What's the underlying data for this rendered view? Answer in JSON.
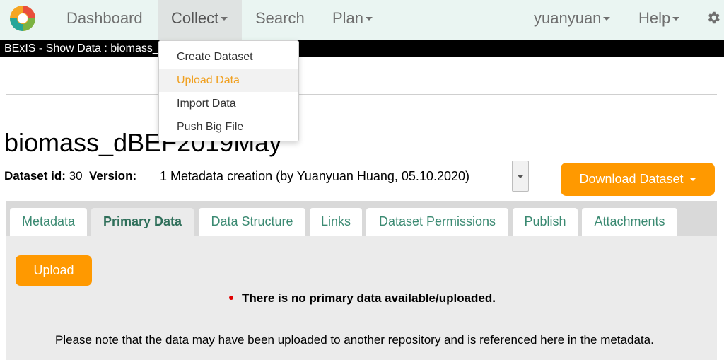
{
  "nav": {
    "items": [
      "Dashboard",
      "Collect",
      "Search",
      "Plan"
    ],
    "user": "yuanyuan",
    "help": "Help",
    "settings_icon": "gear-icon",
    "logo_icon": "bexis-logo"
  },
  "titlebar": {
    "text": "BExIS - Show Data : biomass_dBEF2019May"
  },
  "collect_menu": {
    "items": [
      "Create Dataset",
      "Upload Data",
      "Import Data",
      "Push Big File"
    ],
    "highlighted": "Upload Data",
    "highlight_color": "#f0a020"
  },
  "dataset": {
    "title": "biomass_dBEF2019May",
    "id_label": "Dataset id:",
    "id_value": "30",
    "version_label": "Version:",
    "version_value": "1 Metadata creation (by Yuanyuan Huang, 05.10.2020)",
    "download_label": "Download Dataset"
  },
  "tabs": [
    "Metadata",
    "Primary Data",
    "Data Structure",
    "Links",
    "Dataset Permissions",
    "Publish",
    "Attachments"
  ],
  "active_tab": "Primary Data",
  "primary": {
    "upload_label": "Upload",
    "no_data": "There is no primary data available/uploaded.",
    "note": "Please note that the data may have been uploaded to another repository and is referenced here in the metadata."
  },
  "colors": {
    "accent": "#ff9900",
    "tab_text": "#3b8a72",
    "navbar": "#eaf5f2"
  }
}
